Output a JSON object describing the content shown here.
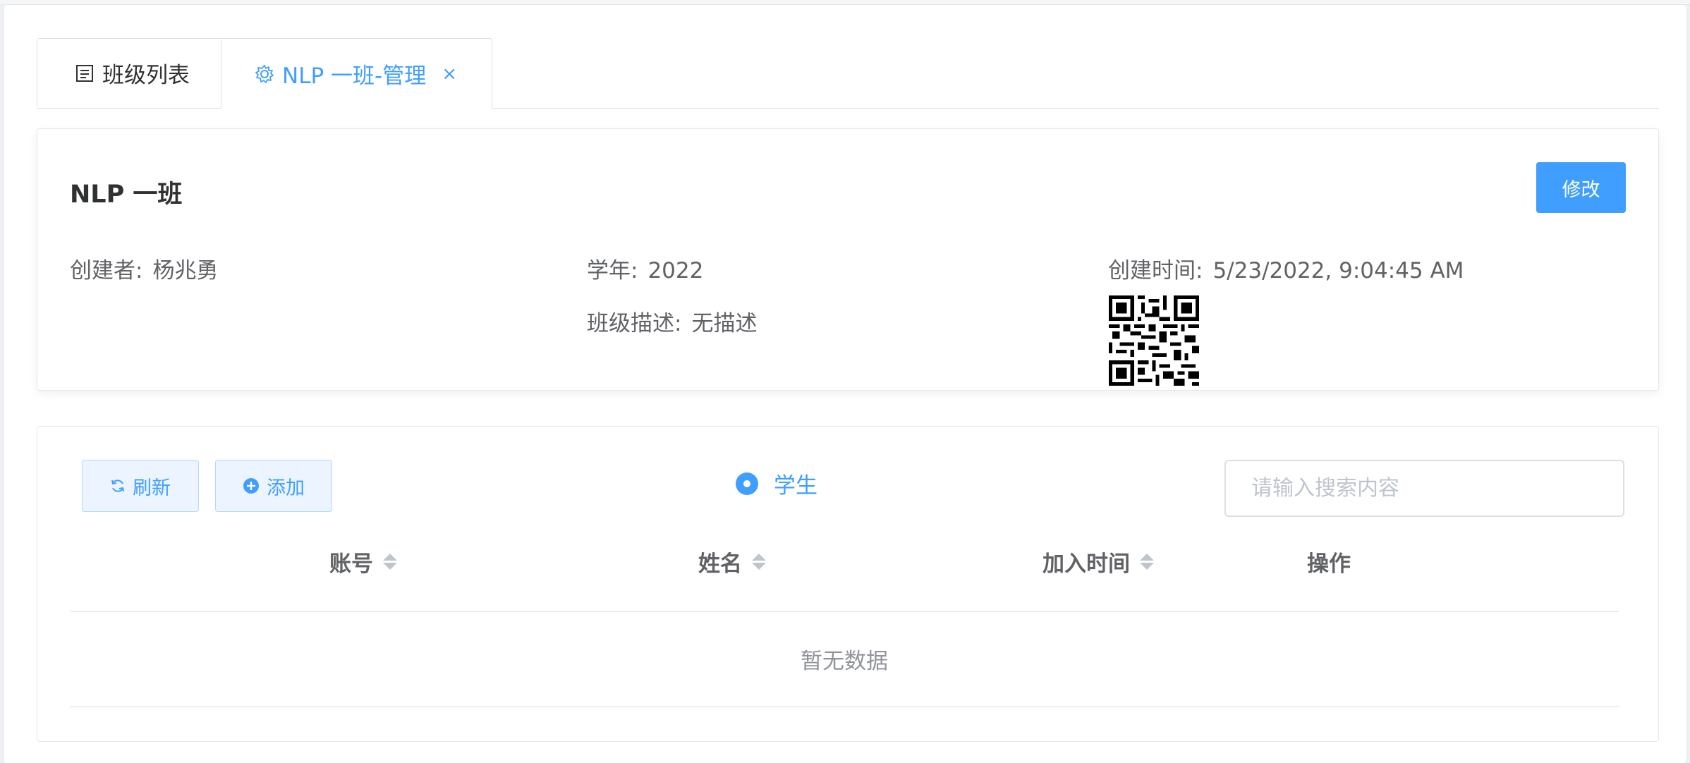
{
  "tabs": [
    {
      "label": "班级列表",
      "icon": "document-icon",
      "active": false
    },
    {
      "label": "NLP 一班-管理",
      "icon": "gear-icon",
      "active": true,
      "close": "×"
    }
  ],
  "class_info": {
    "title": "NLP 一班",
    "edit_label": "修改",
    "creator_label": "创建者:",
    "creator_value": "杨兆勇",
    "year_label": "学年:",
    "year_value": "2022",
    "created_label": "创建时间:",
    "created_value": "5/23/2022, 9:04:45 AM",
    "desc_label": "班级描述:",
    "desc_value": "无描述"
  },
  "toolbar": {
    "refresh_label": "刷新",
    "add_label": "添加",
    "radio_label": "学生",
    "search_placeholder": "请输入搜索内容"
  },
  "table": {
    "columns": [
      "账号",
      "姓名",
      "加入时间",
      "操作"
    ],
    "empty_text": "暂无数据"
  },
  "colors": {
    "accent": "#409eff",
    "text": "#303133",
    "muted": "#606266"
  }
}
